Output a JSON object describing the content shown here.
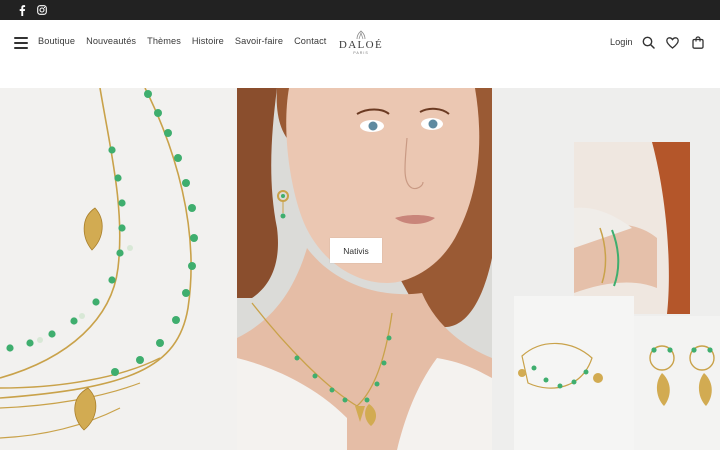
{
  "topbar": {
    "social": [
      {
        "icon": "facebook-icon"
      },
      {
        "icon": "instagram-icon"
      }
    ]
  },
  "header": {
    "menu_icon": "hamburger-menu-icon",
    "nav": [
      "Boutique",
      "Nouveautés",
      "Thèmes",
      "Histoire",
      "Savoir-faire",
      "Contact"
    ],
    "logo": {
      "name": "DALOÉ",
      "sub": "PARIS"
    },
    "login_label": "Login",
    "icons": [
      "search-icon",
      "heart-icon",
      "shopping-bag-icon"
    ]
  },
  "hero": {
    "cta_label": "Nativis",
    "colors": {
      "gold": "#c9a24a",
      "green_bead": "#3fae6e",
      "skin": "#e9c3ad",
      "hair": "#a85a2c"
    }
  }
}
